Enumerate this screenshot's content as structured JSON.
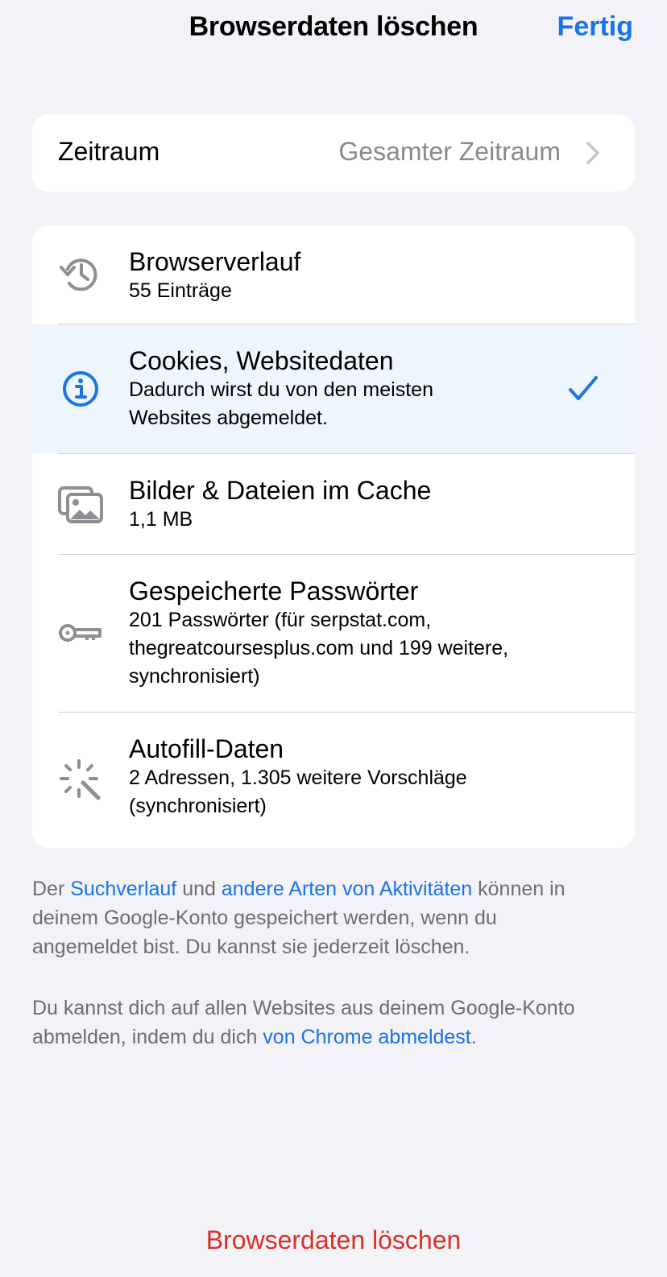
{
  "colors": {
    "accent": "#1A73E8",
    "danger": "#D93025",
    "icon_gray": "#8E8E93"
  },
  "header": {
    "title": "Browserdaten löschen",
    "done_label": "Fertig"
  },
  "period": {
    "label": "Zeitraum",
    "value": "Gesamter Zeitraum",
    "icon": "chevron-right-icon"
  },
  "items": [
    {
      "icon": "history-icon",
      "title": "Browserverlauf",
      "subtitle_lines": [
        "55 Einträge"
      ],
      "selected": false
    },
    {
      "icon": "info-icon",
      "title": "Cookies, Websitedaten",
      "subtitle_lines": [
        "Dadurch wirst du von den meisten",
        "Websites abgemeldet."
      ],
      "selected": true
    },
    {
      "icon": "images-icon",
      "title": "Bilder & Dateien im Cache",
      "subtitle_lines": [
        "1,1 MB"
      ],
      "selected": false
    },
    {
      "icon": "key-icon",
      "title": "Gespeicherte Passwörter",
      "subtitle_lines": [
        "201 Passwörter (für serpstat.com,",
        "thegreatcoursesplus.com und 199 weitere,",
        "synchronisiert)"
      ],
      "selected": false
    },
    {
      "icon": "sparkle-icon",
      "title": "Autofill-Daten",
      "subtitle_lines": [
        "2 Adressen, 1.305 weitere Vorschläge",
        "(synchronisiert)"
      ],
      "selected": false
    }
  ],
  "footer": {
    "p1": {
      "l1_a": "Der ",
      "l1_link1": "Suchverlauf",
      "l1_b": " und ",
      "l1_link2": "andere Arten von Aktivitäten",
      "l1_c": " können in",
      "l2": "deinem Google-Konto gespeichert werden, wenn du",
      "l3": "angemeldet bist. Du kannst sie jederzeit löschen."
    },
    "p2": {
      "l1": "Du kannst dich auf allen Websites aus deinem Google-Konto",
      "l2_a": "abmelden, indem du dich ",
      "l2_link": "von Chrome abmeldest",
      "l2_b": "."
    }
  },
  "delete_label": "Browserdaten löschen"
}
